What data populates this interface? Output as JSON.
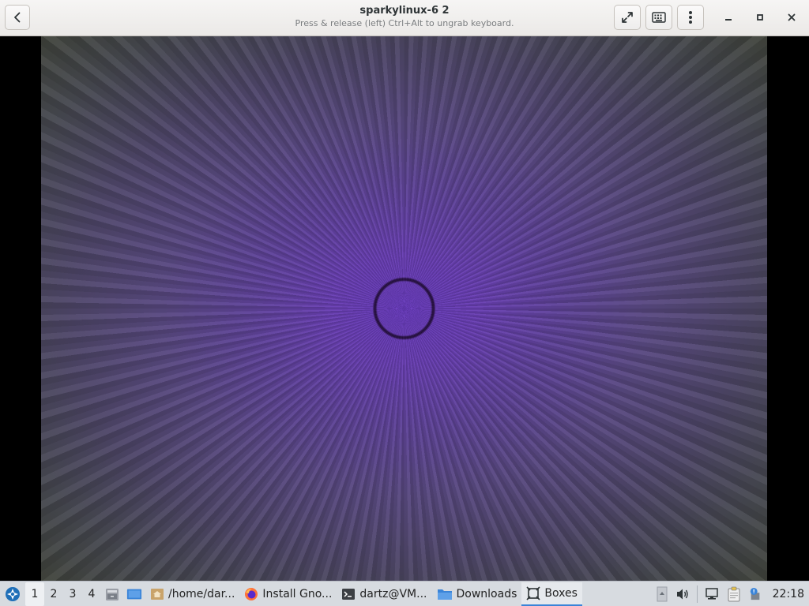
{
  "window": {
    "title": "sparkylinux-6 2",
    "subtitle": "Press & release (left) Ctrl+Alt to ungrab keyboard."
  },
  "icons": {
    "back": "back-arrow-icon",
    "fullscreen": "fullscreen-icon",
    "keyboard": "keyboard-icon",
    "menu": "kebab-menu-icon",
    "minimize": "minimize-icon",
    "maximize": "maximize-icon",
    "close": "close-icon"
  },
  "taskbar": {
    "workspaces": [
      "1",
      "2",
      "3",
      "4"
    ],
    "active_workspace": "1",
    "tasks": [
      {
        "label": "/home/dar...",
        "icon": "folder-home-icon"
      },
      {
        "label": "Install Gno...",
        "icon": "firefox-icon"
      },
      {
        "label": "dartz@VM...",
        "icon": "terminal-icon"
      },
      {
        "label": "Downloads",
        "icon": "folder-icon"
      },
      {
        "label": "Boxes",
        "icon": "boxes-icon"
      }
    ],
    "active_task": "Boxes",
    "clock": "22:18"
  },
  "colors": {
    "accent": "#3a84d8",
    "taskbar": "#d7dbe0",
    "header": "#f0efee"
  }
}
